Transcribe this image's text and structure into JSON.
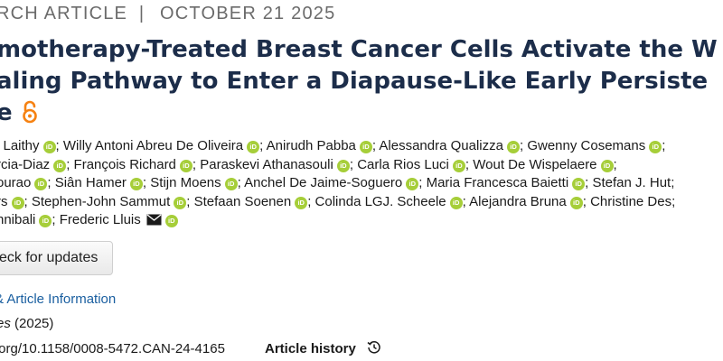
{
  "article": {
    "category": "RCH ARTICLE",
    "separator": "|",
    "date": "OCTOBER 21 2025",
    "title_lines": [
      "motherapy-Treated Breast Cancer Cells Activate the W",
      "aling Pathway to Enter a Diapause-Like Early Persiste",
      "e"
    ],
    "open_access_icon": "open-access-lock-icon",
    "authors_rows": [
      [
        {
          "name": "l Laithy",
          "orcid": true
        },
        {
          "name": "Willy Antoni Abreu De Oliveira",
          "orcid": true
        },
        {
          "name": "Anirudh Pabba",
          "orcid": true
        },
        {
          "name": "Alessandra Qualizza",
          "orcid": true
        },
        {
          "name": "Gwenny Cosemans",
          "orcid": true
        }
      ],
      [
        {
          "name": "rcia-Diaz",
          "orcid": true
        },
        {
          "name": "François Richard",
          "orcid": true
        },
        {
          "name": "Paraskevi Athanasouli",
          "orcid": true
        },
        {
          "name": "Carla Rios Luci",
          "orcid": true
        },
        {
          "name": "Wout De Wispelaere",
          "orcid": true
        }
      ],
      [
        {
          "name": "ourao",
          "orcid": true
        },
        {
          "name": "Siân Hamer",
          "orcid": true
        },
        {
          "name": "Stijn Moens",
          "orcid": true
        },
        {
          "name": "Anchel De Jaime-Soguero",
          "orcid": true
        },
        {
          "name": "Maria Francesca Baietti",
          "orcid": true
        },
        {
          "name": "Stefan J. Hut",
          "orcid": false
        }
      ],
      [
        {
          "name": "rs",
          "orcid": true
        },
        {
          "name": "Stephen-John Sammut",
          "orcid": true
        },
        {
          "name": "Stefaan Soenen",
          "orcid": true
        },
        {
          "name": "Colinda LGJ. Scheele",
          "orcid": true
        },
        {
          "name": "Alejandra Bruna",
          "orcid": true
        },
        {
          "name": "Christine Des",
          "orcid": false
        }
      ],
      [
        {
          "name": "nnibali",
          "orcid": true
        },
        {
          "name": "Frederic Lluis",
          "orcid": true,
          "mail": true
        }
      ]
    ],
    "orcid_label": "iD",
    "author_separator": "; ",
    "check_updates_label": "eck for updates",
    "info_link": "& Article Information",
    "journal_name": "es",
    "journal_year": "(2025)",
    "doi": ".org/10.1158/0008-5472.CAN-24-4165",
    "history_label": "Article history"
  },
  "colors": {
    "title": "#1c2d4a",
    "eyebrow": "#6b6b6b",
    "orcid": "#a6ce39",
    "link": "#1a5fa0",
    "open_access": "#f68212"
  }
}
